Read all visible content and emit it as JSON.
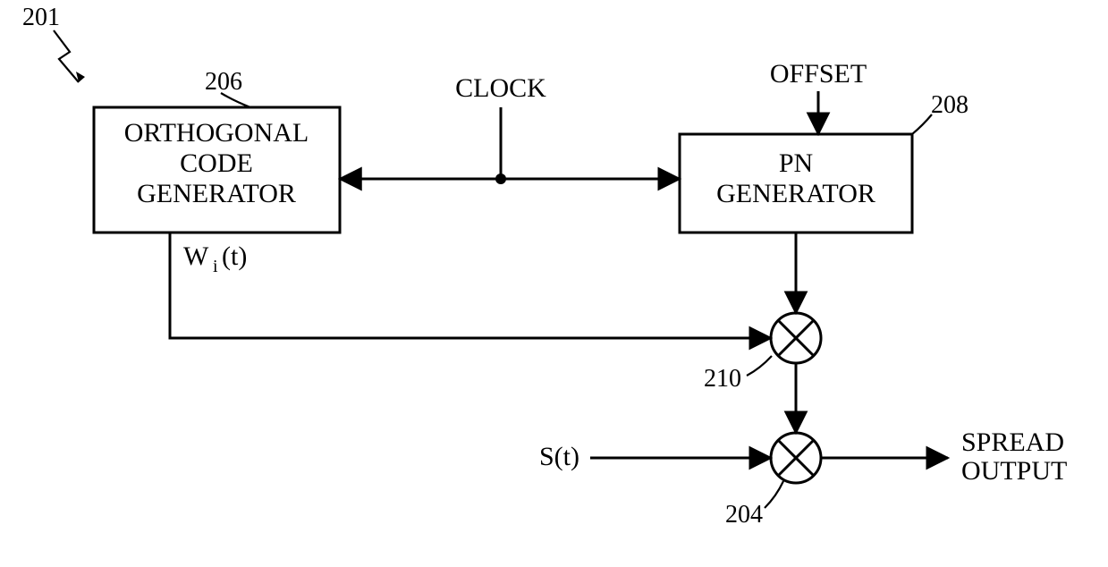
{
  "figure_ref": "201",
  "blocks": {
    "ortho": {
      "ref": "206",
      "line1": "ORTHOGONAL",
      "line2": "CODE",
      "line3": "GENERATOR"
    },
    "pn": {
      "ref": "208",
      "line1": "PN",
      "line2": "GENERATOR"
    }
  },
  "signals": {
    "clock": "CLOCK",
    "offset": "OFFSET",
    "w_main": "W",
    "w_sub": "i",
    "w_arg": "(t)",
    "s": "S(t)",
    "out1": "SPREAD",
    "out2": "OUTPUT"
  },
  "mixers": {
    "m1_ref": "210",
    "m2_ref": "204"
  }
}
